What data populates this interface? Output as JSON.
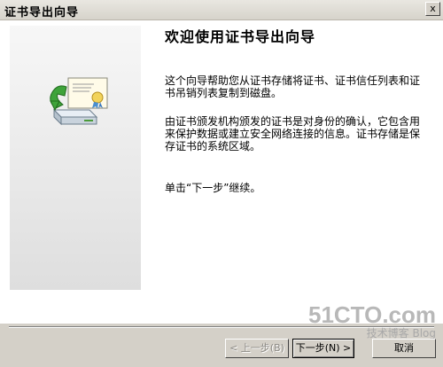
{
  "window": {
    "title": "证书导出向导",
    "close_glyph": "x"
  },
  "side_panel": {
    "icon": "certificate-export-icon"
  },
  "main": {
    "heading": "欢迎使用证书导出向导",
    "paragraph_1": "这个向导帮助您从证书存储将证书、证书信任列表和证书吊销列表复制到磁盘。",
    "paragraph_2": "由证书颁发机构颁发的证书是对身份的确认，它包含用来保护数据或建立安全网络连接的信息。证书存储是保存证书的系统区域。",
    "paragraph_3": "单击“下一步”继续。"
  },
  "buttons": {
    "back_label": "< 上一步(B)",
    "next_label": "下一步(N) >",
    "cancel_label": "取消"
  },
  "watermark": {
    "site": "51CTO.com",
    "tagline": "技术博客 Blog"
  }
}
